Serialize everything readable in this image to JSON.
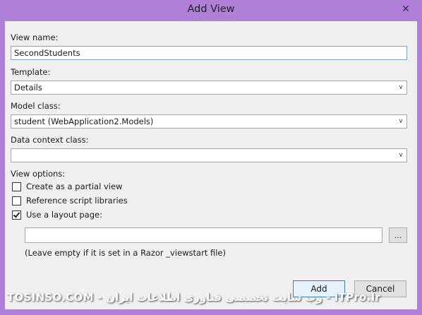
{
  "window": {
    "title": "Add View",
    "close_glyph": "✕"
  },
  "form": {
    "view_name_label": "View name:",
    "view_name_value": "SecondStudents",
    "template_label": "Template:",
    "template_value": "Details",
    "model_class_label": "Model class:",
    "model_class_value": "student (WebApplication2.Models)",
    "data_context_label": "Data context class:",
    "data_context_value": "",
    "view_options_label": "View options:",
    "options": [
      {
        "label": "Create as a partial view",
        "checked": false
      },
      {
        "label": "Reference script libraries",
        "checked": false
      },
      {
        "label": "Use a layout page:",
        "checked": true
      }
    ],
    "layout_page_value": "",
    "browse_label": "...",
    "hint": "(Leave empty if it is set in a Razor _viewstart file)"
  },
  "buttons": {
    "add": "Add",
    "cancel": "Cancel"
  },
  "watermark": "TOSINSO.COM - وب سایت تخصصی فناوری اطلاعات ایران - ITPro.Ir",
  "icons": {
    "close": "close-icon",
    "dropdown": "chevron-down-icon",
    "check": "checkmark-icon"
  },
  "colors": {
    "frame": "#b07fd8",
    "client": "#f0f0f0",
    "default_button_border": "#3c7fb1"
  }
}
